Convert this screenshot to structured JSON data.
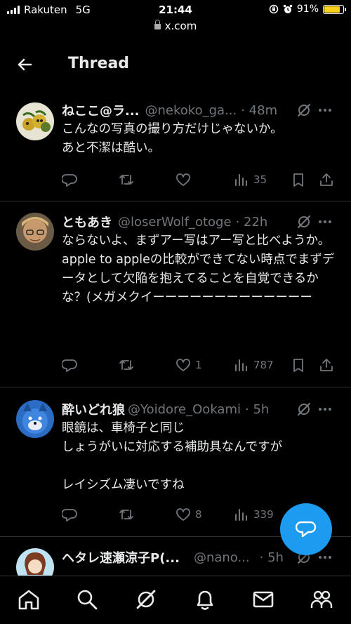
{
  "status_bar": {
    "carrier": "Rakuten",
    "network": "5G",
    "time": "21:44",
    "battery": "91%",
    "battery_level": 0.91
  },
  "url_bar": {
    "domain": "x.com"
  },
  "header": {
    "title": "Thread"
  },
  "tweets": [
    {
      "name": "ねここ@ラ...",
      "handle": "@nekoko_ga...",
      "time": "· 48m",
      "text": "こんなの写真の撮り方だけじゃないか。\nあと不潔は酷い。",
      "reply_count": "",
      "retweet_count": "",
      "like_count": "",
      "view_count": "35"
    },
    {
      "name": "ともあき",
      "handle": "@loserWolf_otoge",
      "time": "· 22h",
      "text": "ならないよ、まずアー写はアー写と比べようか。\napple to appleの比較ができてない時点でまずデータとして欠陥を抱えてることを自覚できるかな？(メガメクイーーーーーーーーーーーーー",
      "reply_count": "",
      "retweet_count": "",
      "like_count": "1",
      "view_count": "787"
    },
    {
      "name": "酔いどれ狼",
      "handle": "@Yoidore_Ookami",
      "time": "· 5h",
      "text": "眼鏡は、車椅子と同じ\nしょうがいに対応する補助具なんですが\n\nレイシズム凄いですね",
      "reply_count": "",
      "retweet_count": "",
      "like_count": "8",
      "view_count": "339"
    },
    {
      "name": "ヘタレ速瀬涼子P(...",
      "handle": "@nano...",
      "time": "· 5h",
      "text": "",
      "reply_count": "",
      "retweet_count": "",
      "like_count": "",
      "view_count": ""
    }
  ],
  "icons": {
    "header": [
      "back-arrow-icon"
    ],
    "tweet_actions": [
      "reply-icon",
      "retweet-icon",
      "like-icon",
      "views-icon",
      "bookmark-icon",
      "share-icon"
    ],
    "fab": "compose-reply-icon",
    "bottom_nav": [
      "home-icon",
      "search-icon",
      "grok-icon",
      "notifications-icon",
      "messages-icon",
      "communities-icon"
    ]
  },
  "colors": {
    "background": "#000000",
    "accent": "#1d9bf0",
    "text": "#e7e9ea",
    "muted": "#71767b",
    "divider": "#2f3336",
    "battery": "#f7d11e"
  }
}
